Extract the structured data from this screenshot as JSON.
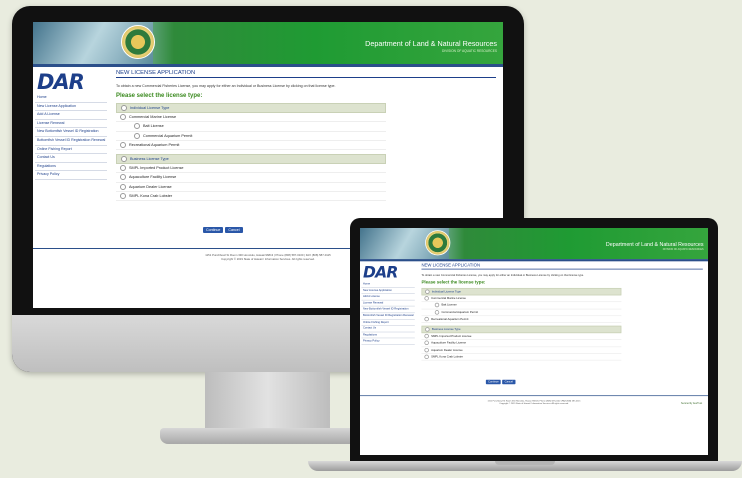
{
  "site": {
    "banner_title": "Department of Land & Natural Resources",
    "banner_subtitle": "DIVISION OF AQUATIC RESOURCES",
    "logo_text": "DAR",
    "sidebar": [
      "Home",
      "New License Application",
      "Add A License",
      "License Renewal",
      "New Bottomfish Vessel ID Registration",
      "Bottomfish Vessel ID Registration Renewal",
      "Online Fishing Report",
      "Contact Us",
      "Regulations",
      "Privacy Policy"
    ],
    "page_title": "NEW LICENSE APPLICATION",
    "intro": "To obtain a new Commercial Fisheries License, you may apply for either an Individual or Business License by clicking on that license type.",
    "select_heading": "Please select the license type:",
    "individual": {
      "header": "Individual License Type",
      "rows": [
        {
          "label": "Commercial Marine License",
          "sub": false
        },
        {
          "label": "Bait License",
          "sub": true
        },
        {
          "label": "Commercial Aquarium Permit",
          "sub": true
        },
        {
          "label": "Recreational Aquarium Permit",
          "sub": false
        }
      ]
    },
    "business": {
      "header": "Business License Type",
      "rows": [
        {
          "label": "SMPL Imported Product License",
          "sub": false
        },
        {
          "label": "Aquaculture Facility License",
          "sub": false
        },
        {
          "label": "Aquarium Dealer License",
          "sub": false
        },
        {
          "label": "SMPL Kona Crab Lobster",
          "sub": false
        }
      ]
    },
    "continue_label": "Continue",
    "cancel_label": "Cancel",
    "footer_line1": "1151 Punchbowl St Room 330 Honolulu, Hawaii 96813  |  Phone (808) 587-0100  |  FAX (808) 587-0115",
    "footer_line2": "Copyright © 2019 State of Hawaii / Information Services. All rights reserved.",
    "ssl_text": "Secured by GeoTrust"
  }
}
